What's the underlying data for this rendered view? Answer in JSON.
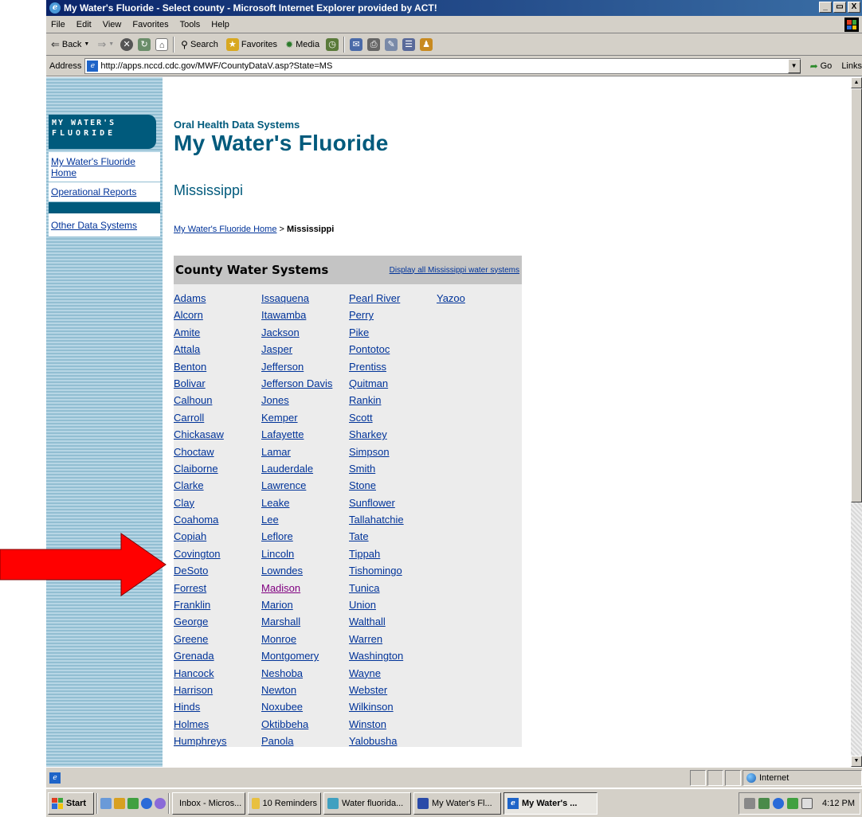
{
  "window": {
    "title": "My Water's Fluoride - Select county - Microsoft Internet Explorer provided by ACT!",
    "controls": [
      "_",
      "̸",
      "X"
    ]
  },
  "menubar": [
    "File",
    "Edit",
    "View",
    "Favorites",
    "Tools",
    "Help"
  ],
  "toolbar": {
    "back": "Back",
    "search": "Search",
    "favorites": "Favorites",
    "media": "Media"
  },
  "address": {
    "label": "Address",
    "url": "http://apps.nccd.cdc.gov/MWF/CountyDataV.asp?State=MS",
    "go": "Go",
    "links": "Links"
  },
  "sidebar": {
    "logo_line1": "MY WATER'S",
    "logo_line2": "FLUORIDE",
    "links": [
      "My Water's Fluoride Home",
      "Operational Reports",
      "Other Data Systems"
    ]
  },
  "page": {
    "kicker": "Oral Health Data Systems",
    "title": "My Water's Fluoride",
    "state": "Mississippi",
    "breadcrumb_home": "My Water's Fluoride Home",
    "breadcrumb_sep": ">",
    "breadcrumb_current": "Mississippi"
  },
  "panel": {
    "title": "County Water Systems",
    "display_all": "Display all Mississippi water systems",
    "columns": [
      [
        "Adams",
        "Alcorn",
        "Amite",
        "Attala",
        "Benton",
        "Bolivar",
        "Calhoun",
        "Carroll",
        "Chickasaw",
        "Choctaw",
        "Claiborne",
        "Clarke",
        "Clay",
        "Coahoma",
        "Copiah",
        "Covington",
        "DeSoto",
        "Forrest",
        "Franklin",
        "George",
        "Greene",
        "Grenada",
        "Hancock",
        "Harrison",
        "Hinds",
        "Holmes",
        "Humphreys"
      ],
      [
        "Issaquena",
        "Itawamba",
        "Jackson",
        "Jasper",
        "Jefferson",
        "Jefferson Davis",
        "Jones",
        "Kemper",
        "Lafayette",
        "Lamar",
        "Lauderdale",
        "Lawrence",
        "Leake",
        "Lee",
        "Leflore",
        "Lincoln",
        "Lowndes",
        "Madison",
        "Marion",
        "Marshall",
        "Monroe",
        "Montgomery",
        "Neshoba",
        "Newton",
        "Noxubee",
        "Oktibbeha",
        "Panola"
      ],
      [
        "Pearl River",
        "Perry",
        "Pike",
        "Pontotoc",
        "Prentiss",
        "Quitman",
        "Rankin",
        "Scott",
        "Sharkey",
        "Simpson",
        "Smith",
        "Stone",
        "Sunflower",
        "Tallahatchie",
        "Tate",
        "Tippah",
        "Tishomingo",
        "Tunica",
        "Union",
        "Walthall",
        "Warren",
        "Washington",
        "Wayne",
        "Webster",
        "Wilkinson",
        "Winston",
        "Yalobusha"
      ],
      [
        "Yazoo"
      ]
    ],
    "visited": [
      "Madison"
    ]
  },
  "status": {
    "zone": "Internet"
  },
  "taskbar": {
    "start": "Start",
    "buttons": [
      "Inbox - Micros...",
      "10 Reminders",
      "Water fluorida...",
      "My Water's Fl...",
      "My Water's ..."
    ],
    "active_index": 4,
    "clock": "4:12 PM"
  },
  "colors": {
    "brand": "#005a7c",
    "link": "#003399",
    "visited": "#800080",
    "arrow": "#ff0000"
  }
}
